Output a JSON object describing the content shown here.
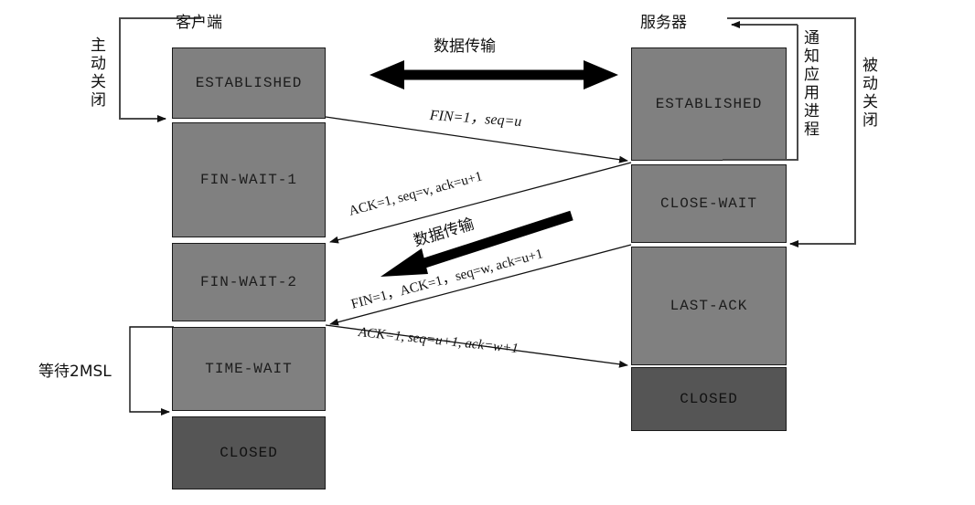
{
  "diagram": {
    "title_client": "客户端",
    "title_server": "服务器",
    "client_side_label": "主动关闭",
    "server_notify_label": "通知应用进程",
    "server_side_label": "被动关闭",
    "wait_label": "等待2MSL",
    "data_transfer_label_top": "数据传输",
    "data_transfer_label_bottom": "数据传输"
  },
  "client_states": [
    {
      "name": "ESTABLISHED",
      "kind": "active"
    },
    {
      "name": "FIN-WAIT-1",
      "kind": "active"
    },
    {
      "name": "FIN-WAIT-2",
      "kind": "active"
    },
    {
      "name": "TIME-WAIT",
      "kind": "active"
    },
    {
      "name": "CLOSED",
      "kind": "closed"
    }
  ],
  "server_states": [
    {
      "name": "ESTABLISHED",
      "kind": "active"
    },
    {
      "name": "CLOSE-WAIT",
      "kind": "active"
    },
    {
      "name": "LAST-ACK",
      "kind": "active"
    },
    {
      "name": "CLOSED",
      "kind": "closed"
    }
  ],
  "messages": [
    {
      "id": "fin1",
      "text": "FIN=1，seq=u",
      "direction": "client-to-server"
    },
    {
      "id": "ack1",
      "text": "ACK=1, seq=v, ack=u+1",
      "direction": "server-to-client"
    },
    {
      "id": "fin2",
      "text": "FIN=1，ACK=1，seq=w, ack=u+1",
      "direction": "server-to-client"
    },
    {
      "id": "ack2",
      "text": "ACK=1, seq=u+1, ack=w+1",
      "direction": "client-to-server"
    }
  ],
  "colors": {
    "box_active": "#808080",
    "box_closed": "#555555",
    "stroke": "#1a1a1a",
    "text": "#111111",
    "background": "#ffffff"
  }
}
